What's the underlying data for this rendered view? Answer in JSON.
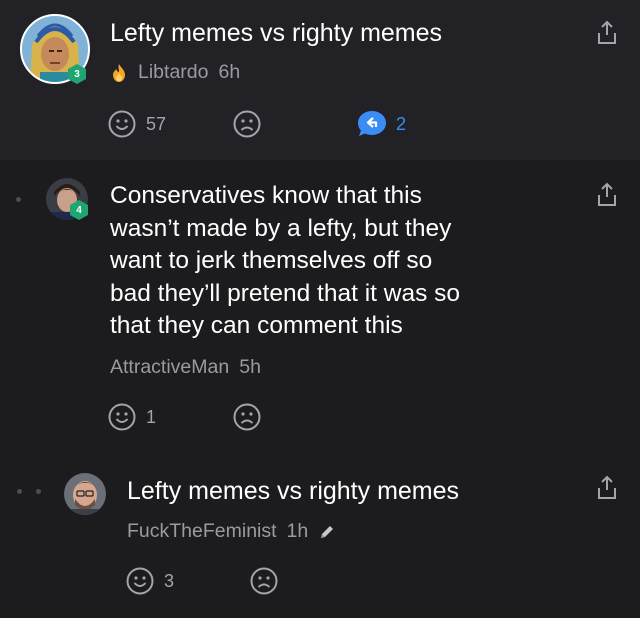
{
  "comments": [
    {
      "text": "Lefty memes vs righty memes",
      "author": "Libtardo",
      "time": "6h",
      "level": "3",
      "likes": "57",
      "replies": "2",
      "author_icon": "fire-icon"
    },
    {
      "text_lines": [
        "Conservatives know that this",
        "wasn’t made by a lefty, but they",
        "want to jerk themselves off so",
        "bad they’ll pretend that it was so",
        "that they can comment this"
      ],
      "author": "AttractiveMan",
      "time": "5h",
      "level": "4",
      "likes": "1"
    },
    {
      "text": "Lefty memes vs righty memes",
      "author": "FuckTheFeminist",
      "time": "1h",
      "likes": "3",
      "edited_icon": "pencil-icon"
    }
  ],
  "colors": {
    "background": "#1c1c1f",
    "highlight_background": "#222226",
    "reply_accent": "#3b8cf5",
    "level_badge": "#1ea672",
    "muted_text": "#9a9aa1"
  }
}
